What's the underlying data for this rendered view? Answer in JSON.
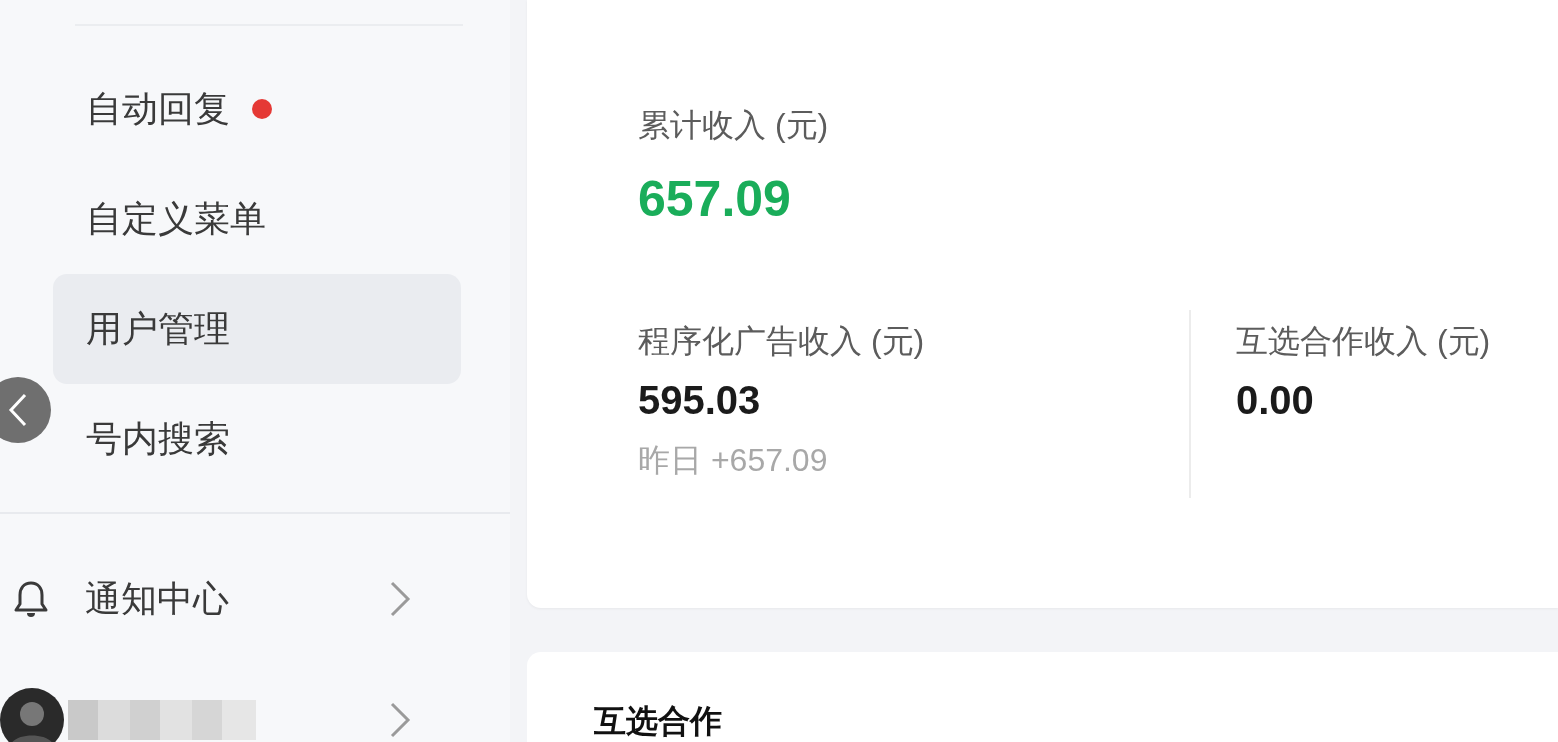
{
  "sidebar": {
    "items": [
      {
        "label": "自动回复",
        "selected": false,
        "dot": true
      },
      {
        "label": "自定义菜单",
        "selected": false,
        "dot": false
      },
      {
        "label": "用户管理",
        "selected": true,
        "dot": false
      },
      {
        "label": "号内搜索",
        "selected": false,
        "dot": false
      }
    ],
    "notification": {
      "label": "通知中心"
    }
  },
  "income_card": {
    "total": {
      "label": "累计收入 (元)",
      "value": "657.09"
    },
    "columns": [
      {
        "label": "程序化广告收入 (元)",
        "value": "595.03",
        "note": "昨日 +657.09"
      },
      {
        "label": "互选合作收入 (元)",
        "value": "0.00"
      }
    ]
  },
  "section": {
    "title": "互选合作"
  }
}
